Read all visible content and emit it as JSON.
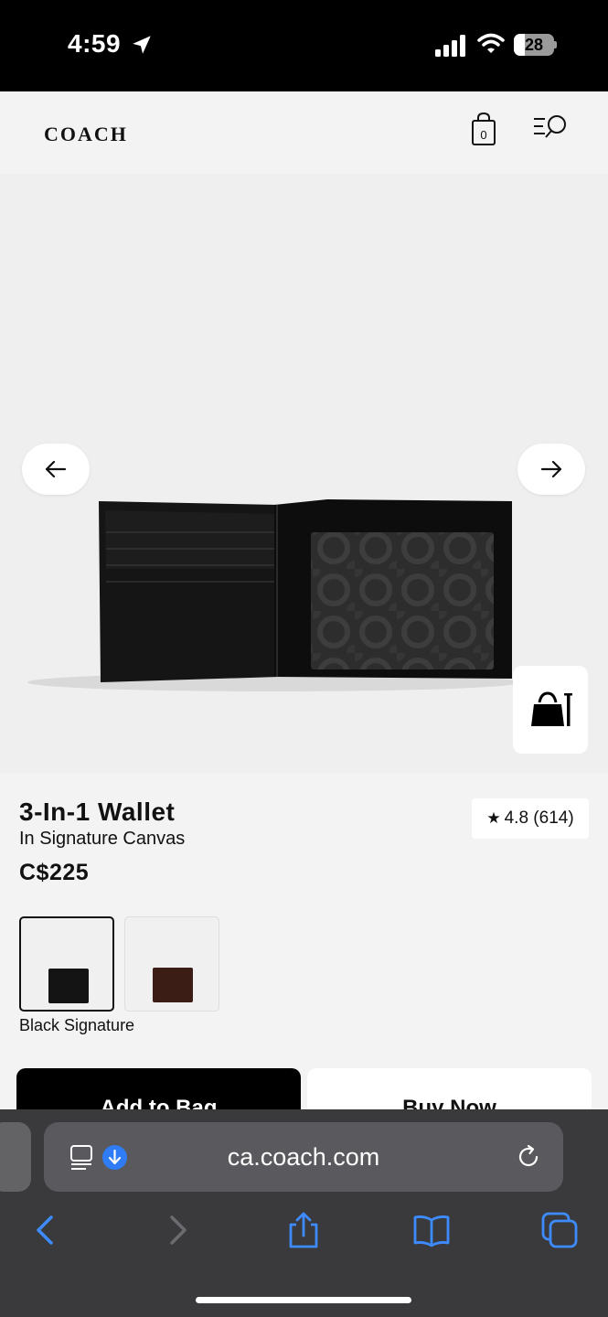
{
  "status_bar": {
    "time": "4:59",
    "battery_level": "28",
    "battery_fraction": 0.28,
    "icons": [
      "location-arrow-icon",
      "signal-icon",
      "wifi-icon",
      "battery-icon"
    ]
  },
  "header": {
    "logo": "COACH",
    "bag_count": "0",
    "icons": [
      "shopping-bag-icon",
      "menu-search-icon"
    ]
  },
  "gallery": {
    "icons": [
      "arrow-left-icon",
      "arrow-right-icon",
      "quick-add-bag-icon"
    ]
  },
  "product": {
    "title": "3-In-1 Wallet",
    "subtitle": "In Signature Canvas",
    "price": "C$225",
    "rating": "4.8",
    "review_count": "(614)",
    "selected_color": "Black Signature",
    "swatch_colors": [
      "#141414",
      "#3b1d16"
    ]
  },
  "actions": {
    "add_to_bag": "Add to Bag",
    "buy_now": "Buy Now"
  },
  "browser": {
    "url": "ca.coach.com",
    "accent": "#2f7cf6",
    "icons": [
      "reader-icon",
      "download-icon",
      "reload-icon",
      "back-icon",
      "forward-icon",
      "share-icon",
      "bookmarks-icon",
      "tabs-icon"
    ]
  }
}
